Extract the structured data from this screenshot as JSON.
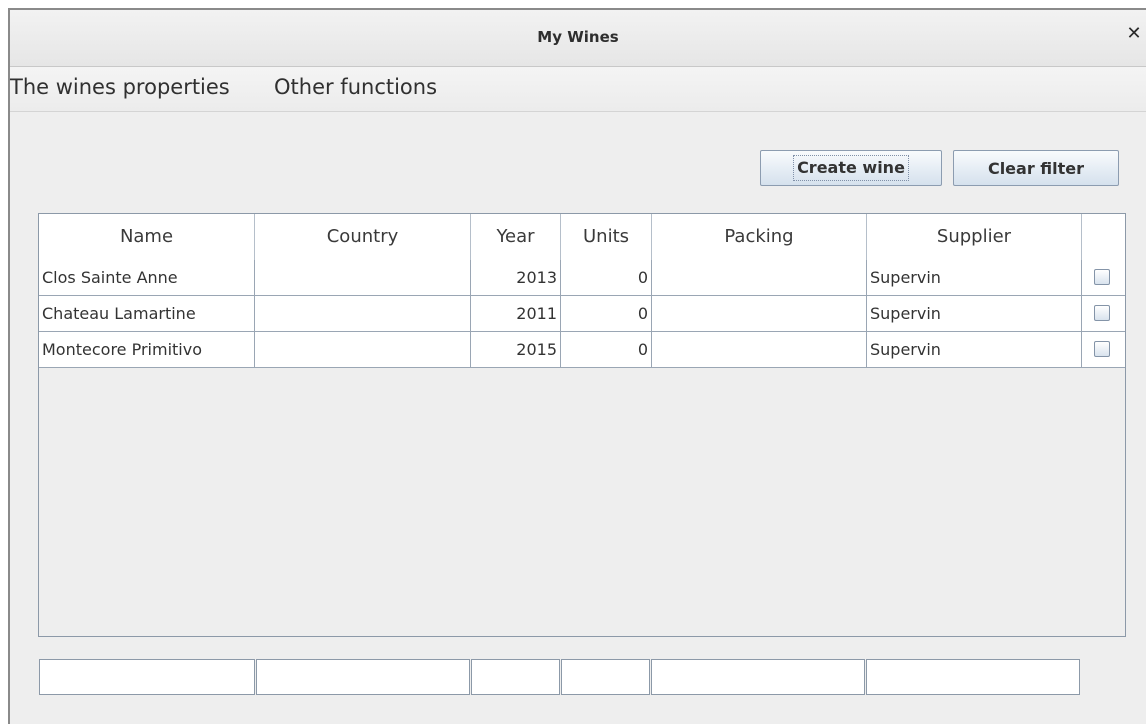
{
  "window": {
    "title": "My Wines"
  },
  "menu": [
    "The wines properties",
    "Other functions"
  ],
  "toolbar": {
    "create_label": "Create wine",
    "clear_label": "Clear filter"
  },
  "table": {
    "columns": [
      "Name",
      "Country",
      "Year",
      "Units",
      "Packing",
      "Supplier",
      ""
    ],
    "rows": [
      {
        "name": "Clos Sainte Anne",
        "country": "",
        "year": "2013",
        "units": "0",
        "packing": "",
        "supplier": "Supervin",
        "checked": false
      },
      {
        "name": "Chateau Lamartine",
        "country": "",
        "year": "2011",
        "units": "0",
        "packing": "",
        "supplier": "Supervin",
        "checked": false
      },
      {
        "name": "Montecore Primitivo",
        "country": "",
        "year": "2015",
        "units": "0",
        "packing": "",
        "supplier": "Supervin",
        "checked": false
      }
    ]
  },
  "filters": {
    "name": "",
    "country": "",
    "year": "",
    "units": "",
    "packing": "",
    "supplier": ""
  }
}
